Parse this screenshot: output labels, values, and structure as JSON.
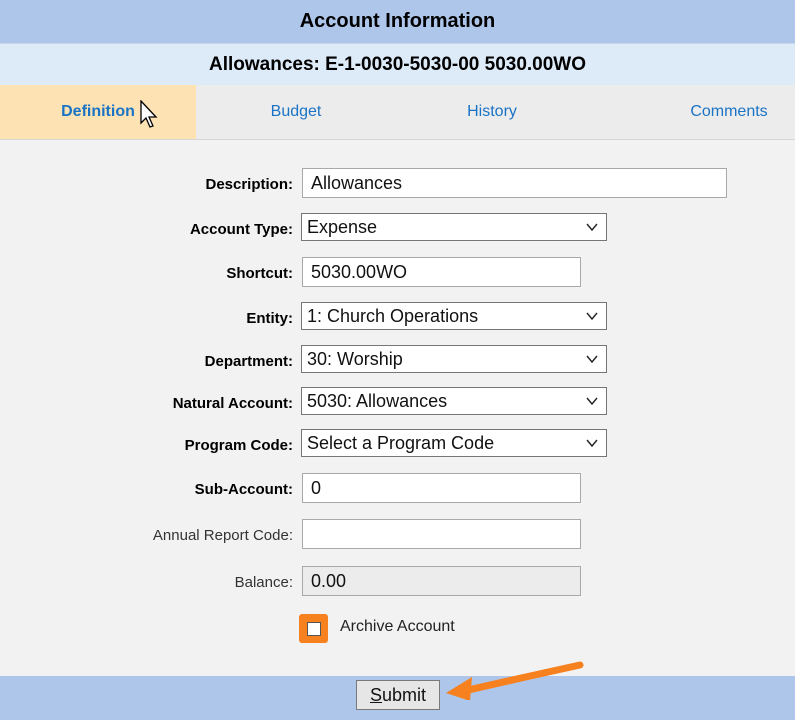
{
  "header": {
    "title": "Account Information"
  },
  "subheader": {
    "title": "Allowances: E-1-0030-5030-00 5030.00WO"
  },
  "tabs": [
    {
      "label": "Definition",
      "active": true
    },
    {
      "label": "Budget"
    },
    {
      "label": "History"
    },
    {
      "label": "Comments"
    }
  ],
  "form": {
    "description": {
      "label": "Description:",
      "value": "Allowances"
    },
    "account_type": {
      "label": "Account Type:",
      "value": "Expense"
    },
    "shortcut": {
      "label": "Shortcut:",
      "value": "5030.00WO"
    },
    "entity": {
      "label": "Entity:",
      "value": "1: Church Operations"
    },
    "department": {
      "label": "Department:",
      "value": "30: Worship"
    },
    "natural_account": {
      "label": "Natural Account:",
      "value": "5030: Allowances"
    },
    "program_code": {
      "label": "Program Code:",
      "value": "Select a Program Code"
    },
    "sub_account": {
      "label": "Sub-Account:",
      "value": "0"
    },
    "annual_report_code": {
      "label": "Annual Report Code:",
      "value": ""
    },
    "balance": {
      "label": "Balance:",
      "value": "0.00"
    },
    "archive": {
      "label": "Archive Account",
      "checked": false
    }
  },
  "footer": {
    "submit_prefix": "S",
    "submit_rest": "ubmit"
  },
  "colors": {
    "header_bg": "#adc6ea",
    "active_tab_bg": "#fde2b4",
    "highlight": "#f7811e",
    "link": "#1a73c5"
  }
}
